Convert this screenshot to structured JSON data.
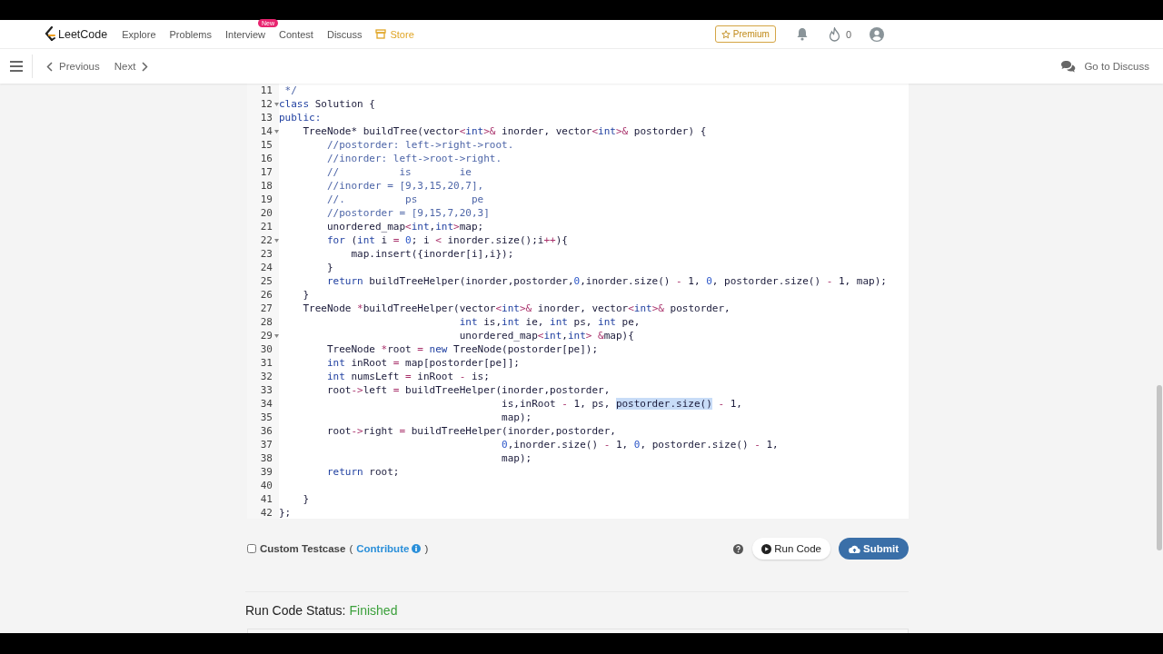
{
  "nav": {
    "logo": "LeetCode",
    "items": [
      {
        "label": "Explore",
        "kind": "link"
      },
      {
        "label": "Problems",
        "kind": "link"
      },
      {
        "label": "Interview",
        "kind": "link",
        "badge": "New"
      },
      {
        "label": "Contest",
        "kind": "link"
      },
      {
        "label": "Discuss",
        "kind": "link"
      },
      {
        "label": "Store",
        "kind": "store"
      }
    ],
    "premium": "Premium",
    "streak": "0"
  },
  "toolbar": {
    "previous": "Previous",
    "next": "Next",
    "discuss": "Go to Discuss"
  },
  "editor": {
    "lines": [
      {
        "number": "11",
        "foldable": false,
        "tokens": [
          {
            "text": " */",
            "kind": "comment"
          }
        ]
      },
      {
        "number": "12",
        "foldable": true,
        "tokens": [
          {
            "text": "class",
            "kind": "keyword"
          },
          {
            "text": " Solution {",
            "kind": "plain"
          }
        ]
      },
      {
        "number": "13",
        "foldable": false,
        "tokens": [
          {
            "text": "public:",
            "kind": "keyword"
          }
        ]
      },
      {
        "number": "14",
        "foldable": true,
        "tokens": [
          {
            "text": "    TreeNode* buildTree(vector",
            "kind": "plain"
          },
          {
            "text": "<",
            "kind": "op"
          },
          {
            "text": "int",
            "kind": "keyword"
          },
          {
            "text": ">&",
            "kind": "op"
          },
          {
            "text": " inorder, vector",
            "kind": "plain"
          },
          {
            "text": "<",
            "kind": "op"
          },
          {
            "text": "int",
            "kind": "keyword"
          },
          {
            "text": ">&",
            "kind": "op"
          },
          {
            "text": " postorder) {",
            "kind": "plain"
          }
        ]
      },
      {
        "number": "15",
        "foldable": false,
        "tokens": [
          {
            "text": "        //postorder: left->right->root.",
            "kind": "comment"
          }
        ]
      },
      {
        "number": "16",
        "foldable": false,
        "tokens": [
          {
            "text": "        //inorder: left->root->right.",
            "kind": "comment"
          }
        ]
      },
      {
        "number": "17",
        "foldable": false,
        "tokens": [
          {
            "text": "        //          is        ie",
            "kind": "comment"
          }
        ]
      },
      {
        "number": "18",
        "foldable": false,
        "tokens": [
          {
            "text": "        //inorder = [9,3,15,20,7],",
            "kind": "comment"
          }
        ]
      },
      {
        "number": "19",
        "foldable": false,
        "tokens": [
          {
            "text": "        //.          ps         pe",
            "kind": "comment"
          }
        ]
      },
      {
        "number": "20",
        "foldable": false,
        "tokens": [
          {
            "text": "        //postorder = [9,15,7,20,3]",
            "kind": "comment"
          }
        ]
      },
      {
        "number": "21",
        "foldable": false,
        "tokens": [
          {
            "text": "        unordered_map",
            "kind": "plain"
          },
          {
            "text": "<",
            "kind": "op"
          },
          {
            "text": "int",
            "kind": "keyword"
          },
          {
            "text": ",",
            "kind": "plain"
          },
          {
            "text": "int",
            "kind": "keyword"
          },
          {
            "text": ">",
            "kind": "op"
          },
          {
            "text": "map;",
            "kind": "plain"
          }
        ]
      },
      {
        "number": "22",
        "foldable": true,
        "tokens": [
          {
            "text": "        for",
            "kind": "keyword"
          },
          {
            "text": " (",
            "kind": "plain"
          },
          {
            "text": "int",
            "kind": "keyword"
          },
          {
            "text": " i ",
            "kind": "plain"
          },
          {
            "text": "= ",
            "kind": "op"
          },
          {
            "text": "0",
            "kind": "number"
          },
          {
            "text": "; i ",
            "kind": "plain"
          },
          {
            "text": "<",
            "kind": "op"
          },
          {
            "text": " inorder.size();i",
            "kind": "plain"
          },
          {
            "text": "++",
            "kind": "op"
          },
          {
            "text": "){",
            "kind": "plain"
          }
        ]
      },
      {
        "number": "23",
        "foldable": false,
        "tokens": [
          {
            "text": "            map.insert({inorder[i],i});",
            "kind": "plain"
          }
        ]
      },
      {
        "number": "24",
        "foldable": false,
        "tokens": [
          {
            "text": "        }",
            "kind": "plain"
          }
        ]
      },
      {
        "number": "25",
        "foldable": false,
        "tokens": [
          {
            "text": "        return",
            "kind": "keyword"
          },
          {
            "text": " buildTreeHelper(inorder,postorder,",
            "kind": "plain"
          },
          {
            "text": "0",
            "kind": "number"
          },
          {
            "text": ",inorder.size() ",
            "kind": "plain"
          },
          {
            "text": "-",
            "kind": "op"
          },
          {
            "text": " 1, ",
            "kind": "plain"
          },
          {
            "text": "0",
            "kind": "number"
          },
          {
            "text": ", postorder.size() ",
            "kind": "plain"
          },
          {
            "text": "-",
            "kind": "op"
          },
          {
            "text": " 1, map);",
            "kind": "plain"
          }
        ]
      },
      {
        "number": "26",
        "foldable": false,
        "tokens": [
          {
            "text": "    }",
            "kind": "plain"
          }
        ]
      },
      {
        "number": "27",
        "foldable": false,
        "tokens": [
          {
            "text": "    TreeNode ",
            "kind": "plain"
          },
          {
            "text": "*",
            "kind": "op"
          },
          {
            "text": "buildTreeHelper(vector",
            "kind": "plain"
          },
          {
            "text": "<",
            "kind": "op"
          },
          {
            "text": "int",
            "kind": "keyword"
          },
          {
            "text": ">&",
            "kind": "op"
          },
          {
            "text": " inorder, vector",
            "kind": "plain"
          },
          {
            "text": "<",
            "kind": "op"
          },
          {
            "text": "int",
            "kind": "keyword"
          },
          {
            "text": ">&",
            "kind": "op"
          },
          {
            "text": " postorder,",
            "kind": "plain"
          }
        ]
      },
      {
        "number": "28",
        "foldable": false,
        "tokens": [
          {
            "text": "                              int",
            "kind": "keyword"
          },
          {
            "text": " is,",
            "kind": "plain"
          },
          {
            "text": "int",
            "kind": "keyword"
          },
          {
            "text": " ie, ",
            "kind": "plain"
          },
          {
            "text": "int",
            "kind": "keyword"
          },
          {
            "text": " ps, ",
            "kind": "plain"
          },
          {
            "text": "int",
            "kind": "keyword"
          },
          {
            "text": " pe,",
            "kind": "plain"
          }
        ]
      },
      {
        "number": "29",
        "foldable": true,
        "tokens": [
          {
            "text": "                              unordered_map",
            "kind": "plain"
          },
          {
            "text": "<",
            "kind": "op"
          },
          {
            "text": "int",
            "kind": "keyword"
          },
          {
            "text": ",",
            "kind": "plain"
          },
          {
            "text": "int",
            "kind": "keyword"
          },
          {
            "text": "> &",
            "kind": "op"
          },
          {
            "text": "map){",
            "kind": "plain"
          }
        ]
      },
      {
        "number": "30",
        "foldable": false,
        "tokens": [
          {
            "text": "        TreeNode ",
            "kind": "plain"
          },
          {
            "text": "*",
            "kind": "op"
          },
          {
            "text": "root ",
            "kind": "plain"
          },
          {
            "text": "= ",
            "kind": "op"
          },
          {
            "text": "new",
            "kind": "keyword"
          },
          {
            "text": " TreeNode(postorder[pe]);",
            "kind": "plain"
          }
        ]
      },
      {
        "number": "31",
        "foldable": false,
        "tokens": [
          {
            "text": "        int",
            "kind": "keyword"
          },
          {
            "text": " inRoot ",
            "kind": "plain"
          },
          {
            "text": "=",
            "kind": "op"
          },
          {
            "text": " map[postorder[pe]];",
            "kind": "plain"
          }
        ]
      },
      {
        "number": "32",
        "foldable": false,
        "tokens": [
          {
            "text": "        int",
            "kind": "keyword"
          },
          {
            "text": " numsLeft ",
            "kind": "plain"
          },
          {
            "text": "=",
            "kind": "op"
          },
          {
            "text": " inRoot ",
            "kind": "plain"
          },
          {
            "text": "-",
            "kind": "op"
          },
          {
            "text": " is;",
            "kind": "plain"
          }
        ]
      },
      {
        "number": "33",
        "foldable": false,
        "tokens": [
          {
            "text": "        root",
            "kind": "plain"
          },
          {
            "text": "->",
            "kind": "op"
          },
          {
            "text": "left ",
            "kind": "plain"
          },
          {
            "text": "=",
            "kind": "op"
          },
          {
            "text": " buildTreeHelper(inorder,postorder,",
            "kind": "plain"
          }
        ]
      },
      {
        "number": "34",
        "foldable": false,
        "tokens": [
          {
            "text": "                                     is,inRoot ",
            "kind": "plain"
          },
          {
            "text": "-",
            "kind": "op"
          },
          {
            "text": " 1, ps, ",
            "kind": "plain"
          },
          {
            "text": "postorder.size()",
            "kind": "selection"
          },
          {
            "text": " -",
            "kind": "op"
          },
          {
            "text": " 1,",
            "kind": "plain"
          }
        ]
      },
      {
        "number": "35",
        "foldable": false,
        "tokens": [
          {
            "text": "                                     map);",
            "kind": "plain"
          }
        ]
      },
      {
        "number": "36",
        "foldable": false,
        "tokens": [
          {
            "text": "        root",
            "kind": "plain"
          },
          {
            "text": "->",
            "kind": "op"
          },
          {
            "text": "right ",
            "kind": "plain"
          },
          {
            "text": "=",
            "kind": "op"
          },
          {
            "text": " buildTreeHelper(inorder,postorder,",
            "kind": "plain"
          }
        ]
      },
      {
        "number": "37",
        "foldable": false,
        "tokens": [
          {
            "text": "                                     0",
            "kind": "number"
          },
          {
            "text": ",inorder.size() ",
            "kind": "plain"
          },
          {
            "text": "-",
            "kind": "op"
          },
          {
            "text": " 1, ",
            "kind": "plain"
          },
          {
            "text": "0",
            "kind": "number"
          },
          {
            "text": ", postorder.size() ",
            "kind": "plain"
          },
          {
            "text": "-",
            "kind": "op"
          },
          {
            "text": " 1,",
            "kind": "plain"
          }
        ]
      },
      {
        "number": "38",
        "foldable": false,
        "tokens": [
          {
            "text": "                                     map);",
            "kind": "plain"
          }
        ]
      },
      {
        "number": "39",
        "foldable": false,
        "tokens": [
          {
            "text": "        return",
            "kind": "keyword"
          },
          {
            "text": " root;",
            "kind": "plain"
          }
        ]
      },
      {
        "number": "40",
        "foldable": false
      },
      {
        "number": "41",
        "foldable": false,
        "tokens": [
          {
            "text": "    }",
            "kind": "plain"
          }
        ]
      },
      {
        "number": "42",
        "foldable": false,
        "tokens": [
          {
            "text": "};",
            "kind": "plain"
          }
        ]
      }
    ]
  },
  "actions": {
    "custom_testcase": {
      "label": "Custom Testcase",
      "checked": false
    },
    "open_paren": "(",
    "contribute": "Contribute",
    "close_paren": ")",
    "run": "Run Code",
    "submit": "Submit"
  },
  "status": {
    "label": "Run Code Status:",
    "value": "Finished"
  }
}
